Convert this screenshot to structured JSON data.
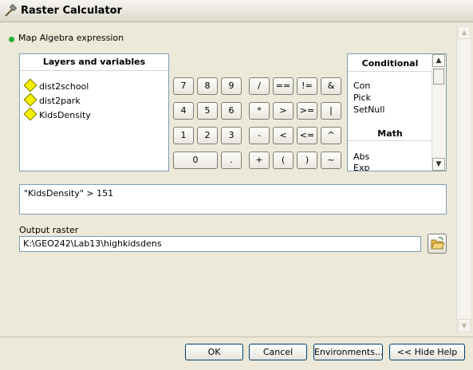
{
  "window": {
    "title": "Raster Calculator"
  },
  "expression_section": {
    "title": "Map Algebra expression"
  },
  "layers": {
    "header": "Layers and variables",
    "items": [
      "dist2school",
      "dist2park",
      "KidsDensity"
    ]
  },
  "calculator": {
    "row1": [
      "7",
      "8",
      "9",
      "/",
      "==",
      "!=",
      "&"
    ],
    "row2": [
      "4",
      "5",
      "6",
      "*",
      ">",
      ">=",
      "|"
    ],
    "row3": [
      "1",
      "2",
      "3",
      "-",
      "<",
      "<=",
      "^"
    ],
    "row4": [
      "0",
      ".",
      "+",
      "(",
      ")",
      "~"
    ]
  },
  "functions": {
    "groups": [
      {
        "header": "Conditional",
        "items": [
          "Con",
          "Pick",
          "SetNull"
        ]
      },
      {
        "header": "Math",
        "items": [
          "Abs",
          "Exp"
        ]
      }
    ]
  },
  "expression": {
    "value": "\"KidsDensity\" > 151"
  },
  "output": {
    "label": "Output raster",
    "value": "K:\\GEO242\\Lab13\\highkidsdens",
    "browse_icon": "folder-open-icon"
  },
  "buttons": {
    "ok": "OK",
    "cancel": "Cancel",
    "environments": "Environments...",
    "hide_help": "<< Hide Help"
  },
  "colors": {
    "accent_dot": "#21b32b",
    "diamond": "#f5ef00",
    "border": "#7f9db9"
  }
}
